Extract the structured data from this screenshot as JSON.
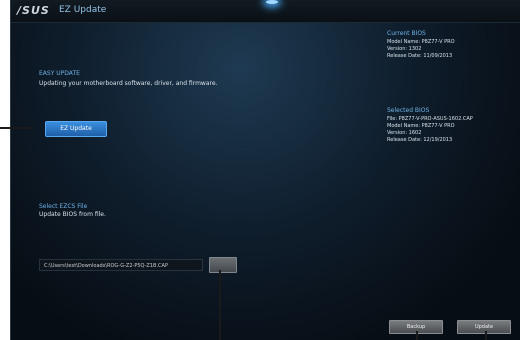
{
  "window": {
    "app_title": "EZ Update",
    "logo_text": "/SUS"
  },
  "easy_update": {
    "heading": "EASY UPDATE",
    "description": "Updating your motherboard software, driver, and firmware.",
    "button_label": "EZ Update"
  },
  "select_file": {
    "heading": "Select EZCS File",
    "description": "Update BIOS from file.",
    "path_value": "C:\\Users\\test\\Downloads\\ROG-G-Z2-P5Q-Z1B.CAP"
  },
  "current_bios": {
    "heading": "Current BIOS",
    "lines": [
      "Model Name: P8Z77-V PRO",
      "Version: 1302",
      "Release Date: 11/09/2013"
    ]
  },
  "selected_bios": {
    "heading": "Selected BIOS",
    "lines": [
      "File: P8Z77-V-PRO-ASUS-1602.CAP",
      "Model Name: P8Z77-V PRO",
      "Version: 1602",
      "Release Date: 12/19/2013"
    ]
  },
  "buttons": {
    "backup": "Backup",
    "update": "Update"
  },
  "colors": {
    "accent": "#3a8fe0",
    "heading": "#6fb3e8",
    "background": "#0a1119"
  }
}
